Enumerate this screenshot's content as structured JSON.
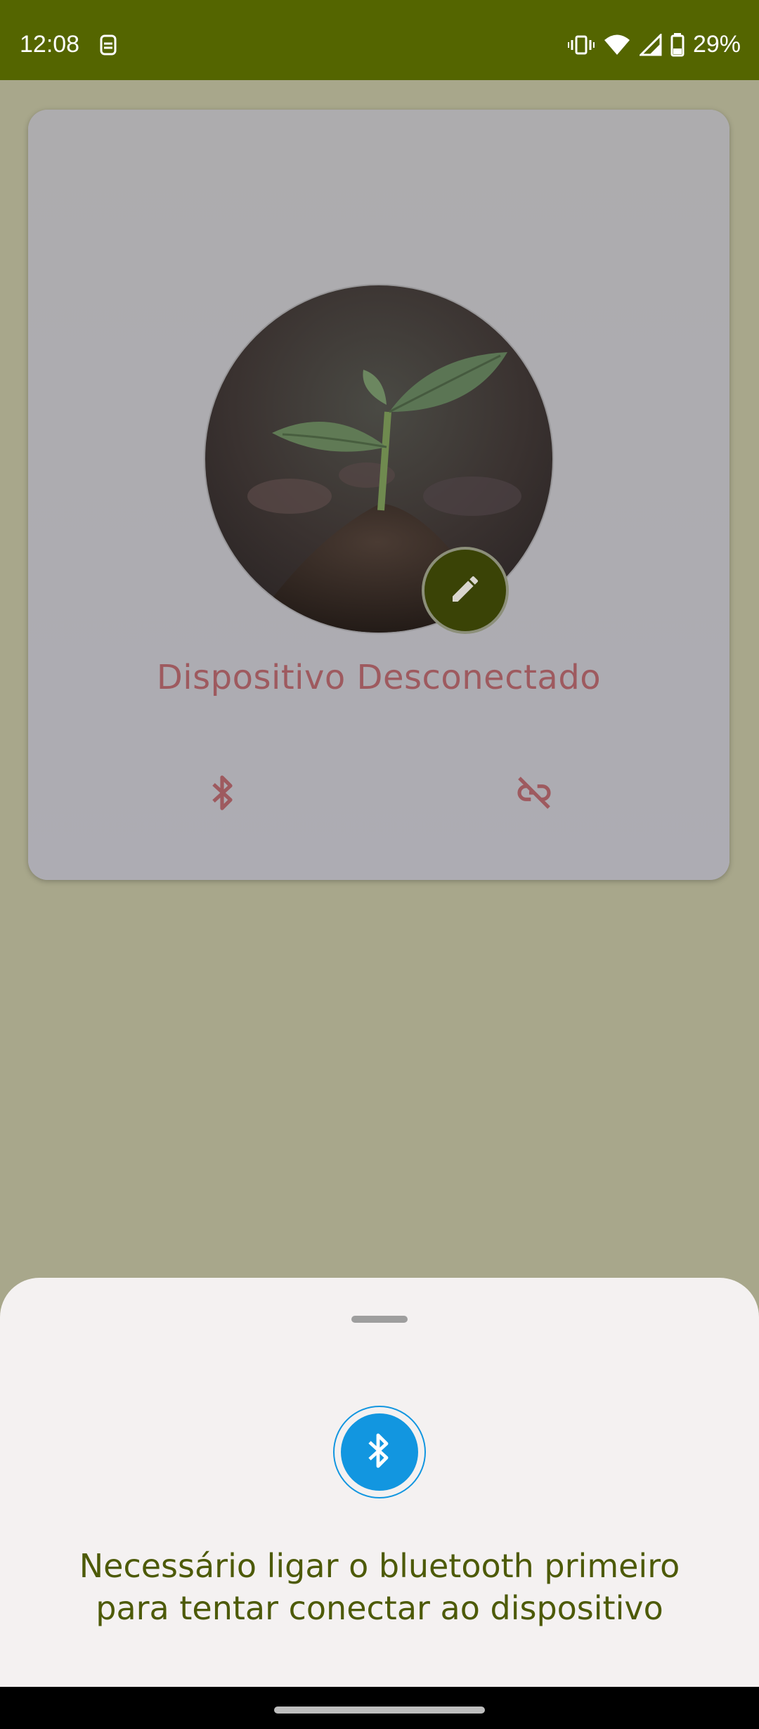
{
  "status_bar": {
    "time": "12:08",
    "battery": "29%",
    "background_color": "#546500"
  },
  "device_card": {
    "status_text": "Dispositivo Desconectado",
    "status_color": "#9e5a5f",
    "icons": [
      "bluetooth-icon",
      "link-off-icon"
    ],
    "avatar_description_icon": "plant-sprout-photo"
  },
  "bottom_sheet": {
    "message_line1": "Necessário ligar o bluetooth primeiro",
    "message_line2": "para tentar conectar ao dispositivo",
    "message_color": "#4d5a08",
    "icon": "bluetooth-icon",
    "icon_color": "#1296e0"
  }
}
